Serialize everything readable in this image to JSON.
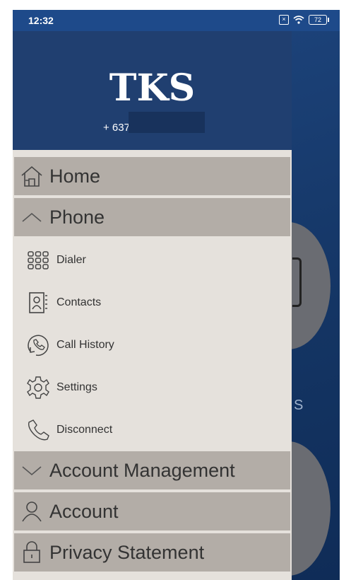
{
  "status_bar": {
    "time": "12:32",
    "battery": "72"
  },
  "drawer": {
    "brand": "TKS",
    "phone_prefix": "+ 637"
  },
  "menu": {
    "home": "Home",
    "phone": "Phone",
    "phone_items": [
      "Dialer",
      "Contacts",
      "Call History",
      "Settings",
      "Disconnect"
    ],
    "account_management": "Account Management",
    "account": "Account",
    "privacy": "Privacy Statement"
  },
  "background": {
    "partial_text": "S"
  },
  "icons": {
    "home": "home-icon",
    "phone": "chevron-up-icon",
    "dialer": "dialpad-icon",
    "contacts": "contacts-book-icon",
    "call_history": "phone-history-icon",
    "settings": "gear-icon",
    "disconnect": "phone-icon",
    "account_management": "chevron-down-icon",
    "account": "person-icon",
    "privacy": "lock-icon"
  }
}
